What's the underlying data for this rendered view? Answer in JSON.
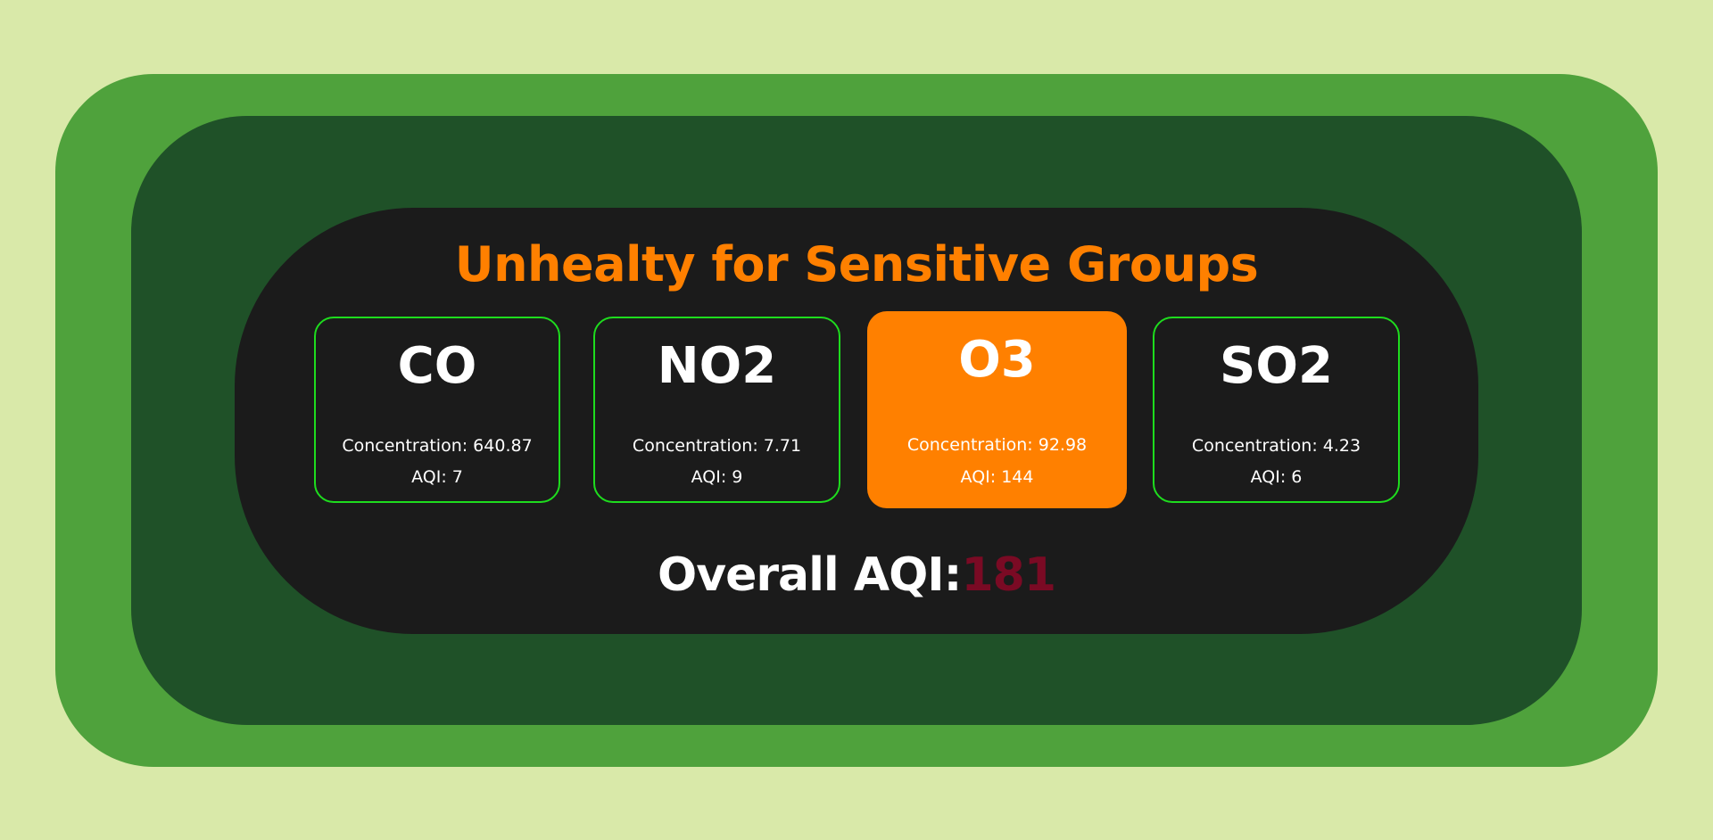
{
  "category": "Unhealty for Sensitive Groups",
  "pollutants": [
    {
      "name": "CO",
      "concentration": "Concentration: 640.87",
      "aqi": "AQI: 7"
    },
    {
      "name": "NO2",
      "concentration": "Concentration: 7.71",
      "aqi": "AQI: 9"
    },
    {
      "name": "O3",
      "concentration": "Concentration: 92.98",
      "aqi": "AQI: 144"
    },
    {
      "name": "SO2",
      "concentration": "Concentration: 4.23",
      "aqi": "AQI: 6"
    }
  ],
  "overall": {
    "label": "Overall AQI:",
    "value": "181"
  },
  "colors": {
    "category": "#ff8000",
    "card_border": "#1edc1e",
    "highlight_card": "#ff8000",
    "overall_value": "#7a0a24"
  }
}
